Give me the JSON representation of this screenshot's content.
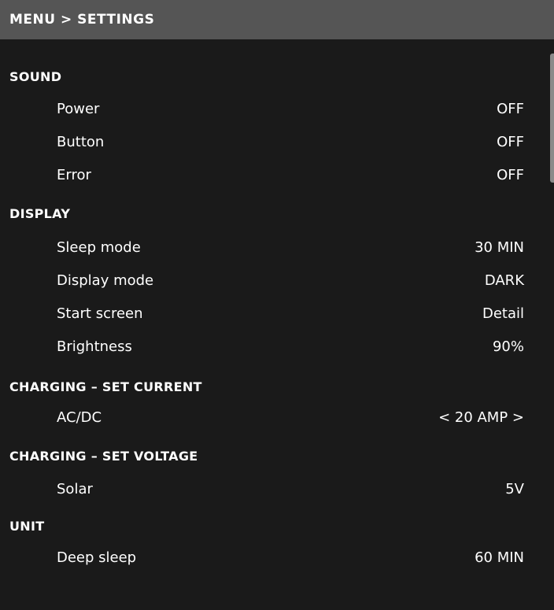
{
  "header": {
    "breadcrumb": "MENU > SETTINGS"
  },
  "sections": [
    {
      "title": "SOUND",
      "rows": [
        {
          "label": "Power",
          "value": "OFF"
        },
        {
          "label": "Button",
          "value": "OFF"
        },
        {
          "label": "Error",
          "value": "OFF"
        }
      ]
    },
    {
      "title": "DISPLAY",
      "rows": [
        {
          "label": "Sleep mode",
          "value": "30 MIN"
        },
        {
          "label": "Display mode",
          "value": "DARK"
        },
        {
          "label": "Start screen",
          "value": "Detail"
        },
        {
          "label": "Brightness",
          "value": "90%"
        }
      ]
    },
    {
      "title": "CHARGING – SET CURRENT",
      "rows": [
        {
          "label": "AC/DC",
          "value": "< 20 AMP >"
        }
      ]
    },
    {
      "title": "CHARGING – SET VOLTAGE",
      "rows": [
        {
          "label": "Solar",
          "value": "5V"
        }
      ]
    },
    {
      "title": "UNIT",
      "rows": [
        {
          "label": "Deep sleep",
          "value": "60 MIN"
        }
      ]
    }
  ],
  "colors": {
    "header_bg": "#555555",
    "body_bg": "#1a1a1a",
    "text": "#ffffff",
    "scrollbar": "#8a8a8a"
  }
}
